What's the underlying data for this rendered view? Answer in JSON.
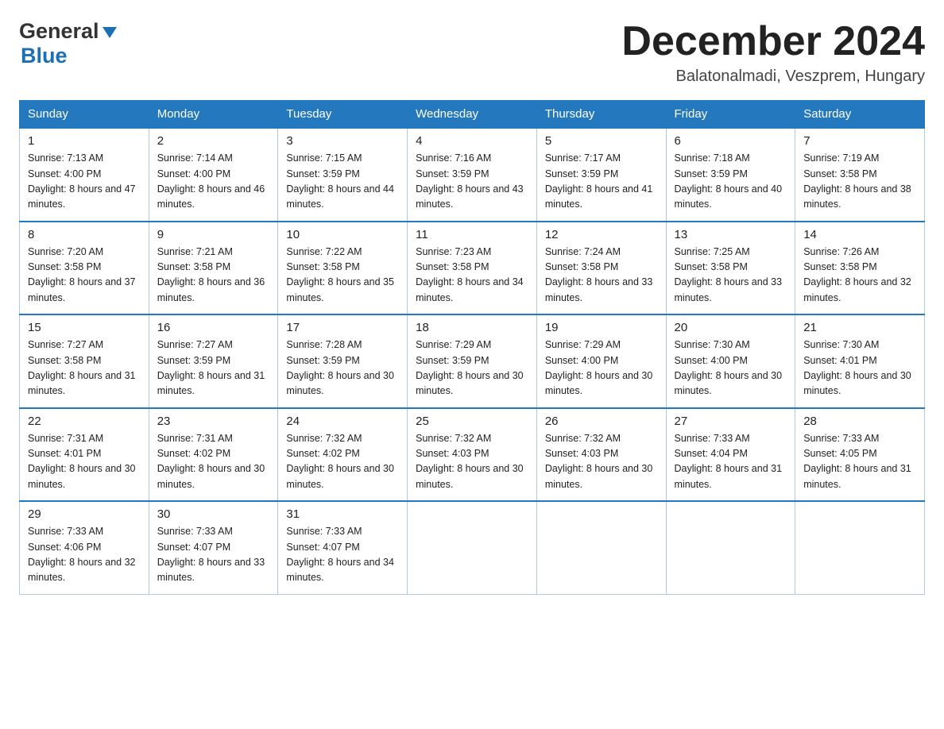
{
  "header": {
    "logo_general": "General",
    "logo_blue": "Blue",
    "month_title": "December 2024",
    "location": "Balatonalmadi, Veszprem, Hungary"
  },
  "weekdays": [
    "Sunday",
    "Monday",
    "Tuesday",
    "Wednesday",
    "Thursday",
    "Friday",
    "Saturday"
  ],
  "weeks": [
    [
      {
        "day": "1",
        "sunrise": "Sunrise: 7:13 AM",
        "sunset": "Sunset: 4:00 PM",
        "daylight": "Daylight: 8 hours and 47 minutes."
      },
      {
        "day": "2",
        "sunrise": "Sunrise: 7:14 AM",
        "sunset": "Sunset: 4:00 PM",
        "daylight": "Daylight: 8 hours and 46 minutes."
      },
      {
        "day": "3",
        "sunrise": "Sunrise: 7:15 AM",
        "sunset": "Sunset: 3:59 PM",
        "daylight": "Daylight: 8 hours and 44 minutes."
      },
      {
        "day": "4",
        "sunrise": "Sunrise: 7:16 AM",
        "sunset": "Sunset: 3:59 PM",
        "daylight": "Daylight: 8 hours and 43 minutes."
      },
      {
        "day": "5",
        "sunrise": "Sunrise: 7:17 AM",
        "sunset": "Sunset: 3:59 PM",
        "daylight": "Daylight: 8 hours and 41 minutes."
      },
      {
        "day": "6",
        "sunrise": "Sunrise: 7:18 AM",
        "sunset": "Sunset: 3:59 PM",
        "daylight": "Daylight: 8 hours and 40 minutes."
      },
      {
        "day": "7",
        "sunrise": "Sunrise: 7:19 AM",
        "sunset": "Sunset: 3:58 PM",
        "daylight": "Daylight: 8 hours and 38 minutes."
      }
    ],
    [
      {
        "day": "8",
        "sunrise": "Sunrise: 7:20 AM",
        "sunset": "Sunset: 3:58 PM",
        "daylight": "Daylight: 8 hours and 37 minutes."
      },
      {
        "day": "9",
        "sunrise": "Sunrise: 7:21 AM",
        "sunset": "Sunset: 3:58 PM",
        "daylight": "Daylight: 8 hours and 36 minutes."
      },
      {
        "day": "10",
        "sunrise": "Sunrise: 7:22 AM",
        "sunset": "Sunset: 3:58 PM",
        "daylight": "Daylight: 8 hours and 35 minutes."
      },
      {
        "day": "11",
        "sunrise": "Sunrise: 7:23 AM",
        "sunset": "Sunset: 3:58 PM",
        "daylight": "Daylight: 8 hours and 34 minutes."
      },
      {
        "day": "12",
        "sunrise": "Sunrise: 7:24 AM",
        "sunset": "Sunset: 3:58 PM",
        "daylight": "Daylight: 8 hours and 33 minutes."
      },
      {
        "day": "13",
        "sunrise": "Sunrise: 7:25 AM",
        "sunset": "Sunset: 3:58 PM",
        "daylight": "Daylight: 8 hours and 33 minutes."
      },
      {
        "day": "14",
        "sunrise": "Sunrise: 7:26 AM",
        "sunset": "Sunset: 3:58 PM",
        "daylight": "Daylight: 8 hours and 32 minutes."
      }
    ],
    [
      {
        "day": "15",
        "sunrise": "Sunrise: 7:27 AM",
        "sunset": "Sunset: 3:58 PM",
        "daylight": "Daylight: 8 hours and 31 minutes."
      },
      {
        "day": "16",
        "sunrise": "Sunrise: 7:27 AM",
        "sunset": "Sunset: 3:59 PM",
        "daylight": "Daylight: 8 hours and 31 minutes."
      },
      {
        "day": "17",
        "sunrise": "Sunrise: 7:28 AM",
        "sunset": "Sunset: 3:59 PM",
        "daylight": "Daylight: 8 hours and 30 minutes."
      },
      {
        "day": "18",
        "sunrise": "Sunrise: 7:29 AM",
        "sunset": "Sunset: 3:59 PM",
        "daylight": "Daylight: 8 hours and 30 minutes."
      },
      {
        "day": "19",
        "sunrise": "Sunrise: 7:29 AM",
        "sunset": "Sunset: 4:00 PM",
        "daylight": "Daylight: 8 hours and 30 minutes."
      },
      {
        "day": "20",
        "sunrise": "Sunrise: 7:30 AM",
        "sunset": "Sunset: 4:00 PM",
        "daylight": "Daylight: 8 hours and 30 minutes."
      },
      {
        "day": "21",
        "sunrise": "Sunrise: 7:30 AM",
        "sunset": "Sunset: 4:01 PM",
        "daylight": "Daylight: 8 hours and 30 minutes."
      }
    ],
    [
      {
        "day": "22",
        "sunrise": "Sunrise: 7:31 AM",
        "sunset": "Sunset: 4:01 PM",
        "daylight": "Daylight: 8 hours and 30 minutes."
      },
      {
        "day": "23",
        "sunrise": "Sunrise: 7:31 AM",
        "sunset": "Sunset: 4:02 PM",
        "daylight": "Daylight: 8 hours and 30 minutes."
      },
      {
        "day": "24",
        "sunrise": "Sunrise: 7:32 AM",
        "sunset": "Sunset: 4:02 PM",
        "daylight": "Daylight: 8 hours and 30 minutes."
      },
      {
        "day": "25",
        "sunrise": "Sunrise: 7:32 AM",
        "sunset": "Sunset: 4:03 PM",
        "daylight": "Daylight: 8 hours and 30 minutes."
      },
      {
        "day": "26",
        "sunrise": "Sunrise: 7:32 AM",
        "sunset": "Sunset: 4:03 PM",
        "daylight": "Daylight: 8 hours and 30 minutes."
      },
      {
        "day": "27",
        "sunrise": "Sunrise: 7:33 AM",
        "sunset": "Sunset: 4:04 PM",
        "daylight": "Daylight: 8 hours and 31 minutes."
      },
      {
        "day": "28",
        "sunrise": "Sunrise: 7:33 AM",
        "sunset": "Sunset: 4:05 PM",
        "daylight": "Daylight: 8 hours and 31 minutes."
      }
    ],
    [
      {
        "day": "29",
        "sunrise": "Sunrise: 7:33 AM",
        "sunset": "Sunset: 4:06 PM",
        "daylight": "Daylight: 8 hours and 32 minutes."
      },
      {
        "day": "30",
        "sunrise": "Sunrise: 7:33 AM",
        "sunset": "Sunset: 4:07 PM",
        "daylight": "Daylight: 8 hours and 33 minutes."
      },
      {
        "day": "31",
        "sunrise": "Sunrise: 7:33 AM",
        "sunset": "Sunset: 4:07 PM",
        "daylight": "Daylight: 8 hours and 34 minutes."
      },
      null,
      null,
      null,
      null
    ]
  ]
}
